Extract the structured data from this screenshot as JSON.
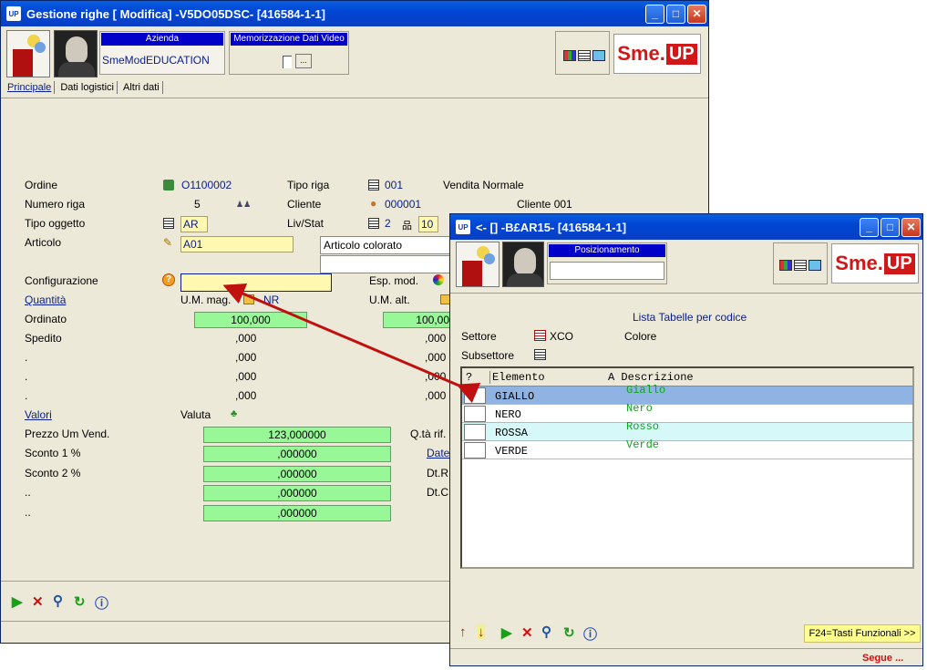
{
  "main_window": {
    "title": "Gestione righe [ Modifica] -V5DO05DSC- [416584-1-1]",
    "azienda_label": "Azienda",
    "azienda_value": "SmeModEDUCATION",
    "memorizzazione_label": "Memorizzazione Dati Video",
    "memorizzazione_btn": "...",
    "tabs": [
      {
        "label": "Principale",
        "active": true
      },
      {
        "label": "Dati logistici",
        "active": false
      },
      {
        "label": "Altri dati",
        "active": false
      }
    ],
    "fields": {
      "ordine_label": "Ordine",
      "ordine_value": "O1100002",
      "numero_riga_label": "Numero riga",
      "numero_riga_value": "5",
      "tipo_oggetto_label": "Tipo oggetto",
      "tipo_oggetto_value": "AR",
      "articolo_label": "Articolo",
      "articolo_value": "A01",
      "articolo_desc": "Articolo colorato",
      "tipo_riga_label": "Tipo riga",
      "tipo_riga_value": "001",
      "tipo_riga_desc": "Vendita Normale",
      "cliente_label": "Cliente",
      "cliente_value": "000001",
      "cliente_desc": "Cliente 001",
      "livstat_label": "Liv/Stat",
      "liv_value": "2",
      "stat_value": "10",
      "configurazione_label": "Configurazione",
      "configurazione_value": "",
      "esp_mod_label": "Esp. mod.",
      "quantita_label": "Quantità",
      "um_mag_label": "U.M. mag.",
      "um_mag_value": "NR",
      "um_alt_label": "U.M. alt.",
      "ordinato_label": "Ordinato",
      "ordinato_value": "100,000",
      "ordinato_alt_value": "100,00",
      "spedito_label": "Spedito",
      "spedito_value": ",000",
      "spedito_alt_value": ",000",
      "dot1_label": ".",
      "dot1_value": ",000",
      "dot1_alt": ",000",
      "dot2_label": ".",
      "dot2_value": ",000",
      "dot2_alt": ",000",
      "dot3_label": ".",
      "dot3_value": ",000",
      "dot3_alt": ",000",
      "valori_label": "Valori",
      "valuta_label": "Valuta",
      "prezzo_label": "Prezzo Um Vend.",
      "prezzo_value": "123,000000",
      "qta_rif_label": "Q.tà rif.",
      "sconto1_label": "Sconto 1 %",
      "sconto1_value": ",000000",
      "date_label": "Date",
      "sconto2_label": "Sconto 2 %",
      "sconto2_value": ",000000",
      "dtr_label": "Dt.R",
      "dd1_label": "..",
      "dd1_value": ",000000",
      "dtc_label": "Dt.C",
      "dd2_label": "..",
      "dd2_value": ",000000"
    }
  },
  "popup_window": {
    "title": "<- [] -B£AR15- [416584-1-1]",
    "posizionamento_label": "Posizionamento",
    "posizionamento_value": "",
    "list_title": "Lista Tabelle per codice",
    "settore_label": "Settore",
    "settore_value": "XCO",
    "settore_desc": "Colore",
    "subsettore_label": "Subsettore",
    "grid_headers": {
      "sel": "?",
      "elemento": "Elemento",
      "descrizione": "A Descrizione"
    },
    "rows": [
      {
        "elemento": "GIALLO",
        "descrizione": "Giallo",
        "selected": true
      },
      {
        "elemento": "NERO",
        "descrizione": "Nero",
        "selected": false
      },
      {
        "elemento": "ROSSA",
        "descrizione": "Rosso",
        "selected": false
      },
      {
        "elemento": "VERDE",
        "descrizione": "Verde",
        "selected": false
      }
    ],
    "f24_label": "F24=Tasti Funzionali >>",
    "segue_label": "Segue ..."
  },
  "brand": {
    "sme": "Sme.",
    "up": "UP",
    "app_icon": "UP"
  },
  "colors": {
    "title_blue": "#0046d5",
    "field_yellow": "#fff8b0",
    "field_green": "#98f898",
    "selected_row": "#8fb4e4",
    "alt_row": "#d6f8f8",
    "arrow_red": "#c01010"
  }
}
